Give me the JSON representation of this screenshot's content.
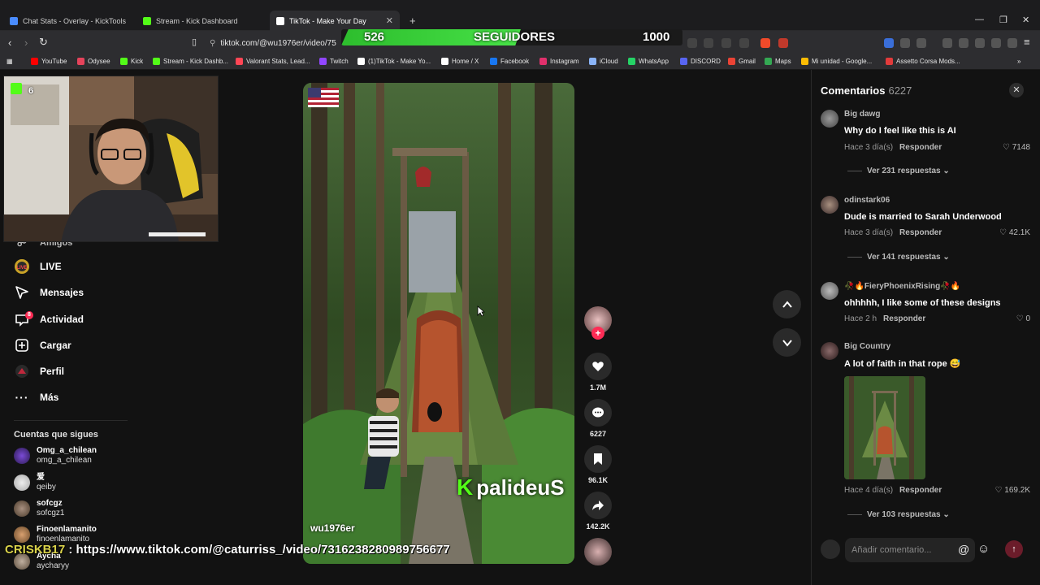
{
  "browser": {
    "tabs": [
      {
        "label": "Chat Stats - Overlay - KickTools",
        "color": "#4a8cff"
      },
      {
        "label": "Stream - Kick Dashboard",
        "color": "#53fc18"
      },
      {
        "label": "TikTok - Make Your Day",
        "color": "#ffffff"
      }
    ],
    "new_tab": "+",
    "url": "tiktok.com/@wu1976er/video/75",
    "bookmarks": [
      {
        "label": "YouTube",
        "color": "#ff0000"
      },
      {
        "label": "Odysee",
        "color": "#e5435b"
      },
      {
        "label": "Kick",
        "color": "#53fc18"
      },
      {
        "label": "Stream - Kick Dashb...",
        "color": "#53fc18"
      },
      {
        "label": "Valorant Stats, Lead...",
        "color": "#ff4655"
      },
      {
        "label": "Twitch",
        "color": "#9146ff"
      },
      {
        "label": "(1)TikTok - Make Yo...",
        "color": "#ffffff"
      },
      {
        "label": "Home / X",
        "color": "#ffffff"
      },
      {
        "label": "Facebook",
        "color": "#1877f2"
      },
      {
        "label": "Instagram",
        "color": "#e1306c"
      },
      {
        "label": "iCloud",
        "color": "#8ab4f8"
      },
      {
        "label": "WhatsApp",
        "color": "#25d366"
      },
      {
        "label": "DISCORD",
        "color": "#5865f2"
      },
      {
        "label": "Gmail",
        "color": "#ea4335"
      },
      {
        "label": "Maps",
        "color": "#34a853"
      },
      {
        "label": "Mi unidad - Google...",
        "color": "#fbbc04"
      },
      {
        "label": "Assetto Corsa Mods...",
        "color": "#e23b3b"
      }
    ]
  },
  "goal": {
    "current": "526",
    "label": "SEGUIDORES",
    "target": "1000",
    "progress": 0.526
  },
  "sidebar": {
    "partial_item": "Amigos",
    "items": [
      {
        "label": "LIVE",
        "icon": "live-icon"
      },
      {
        "label": "Mensajes",
        "icon": "send-icon"
      },
      {
        "label": "Actividad",
        "icon": "inbox-icon",
        "badge": "8"
      },
      {
        "label": "Cargar",
        "icon": "upload-icon"
      },
      {
        "label": "Perfil",
        "icon": "profile-icon"
      },
      {
        "label": "Más",
        "icon": "more-icon"
      }
    ],
    "following_title": "Cuentas que sigues",
    "following": [
      {
        "name": "Omg_a_chilean",
        "handle": "omg_a_chilean",
        "color": "#7b4bd6"
      },
      {
        "name": "爱",
        "handle": "qeiby",
        "color": "#dddddd"
      },
      {
        "name": "sofcgz",
        "handle": "sofcgz1",
        "color": "#8a7a6a"
      },
      {
        "name": "Finoenlamanito",
        "handle": "finoenlamanito",
        "color": "#c7905e"
      },
      {
        "name": "Aycha",
        "handle": "aycharyy",
        "color": "#b0a090"
      }
    ]
  },
  "webcam": {
    "viewer_count": "6"
  },
  "video": {
    "username": "wu1976er",
    "watermark": "palideuS",
    "actions": [
      {
        "name": "like",
        "count": "1.7M"
      },
      {
        "name": "comment",
        "count": "6227"
      },
      {
        "name": "save",
        "count": "96.1K"
      },
      {
        "name": "share",
        "count": "142.2K"
      }
    ]
  },
  "comments": {
    "title": "Comentarios",
    "count": "6227",
    "list": [
      {
        "user": "Big dawg",
        "text": "Why do I feel like this is AI",
        "time": "Hace 3 día(s)",
        "reply": "Responder",
        "likes": "7148",
        "replies": "Ver 231 respuestas",
        "color": "#666666"
      },
      {
        "user": "odinstark06",
        "text": "Dude is married to Sarah Underwood",
        "time": "Hace 3 día(s)",
        "reply": "Responder",
        "likes": "42.1K",
        "replies": "Ver 141 respuestas",
        "color": "#7a6a5a"
      },
      {
        "user": "🥀🔥FieryPhoenixRising🥀🔥",
        "text": "ohhhhh, I like some of these designs",
        "time": "Hace 2 h",
        "reply": "Responder",
        "likes": "0",
        "replies": "",
        "color": "#888888"
      },
      {
        "user": "Big Country",
        "text": "A lot of faith in that rope 😅",
        "time": "Hace 4 día(s)",
        "reply": "Responder",
        "likes": "169.2K",
        "replies": "Ver 103 respuestas",
        "color": "#4a3a3a"
      }
    ],
    "input_placeholder": "Añadir comentario..."
  },
  "chat": {
    "user": "CRISKB17",
    "separator": " : ",
    "message": "https://www.tiktok.com/@caturriss_/video/7316238280989756677"
  }
}
